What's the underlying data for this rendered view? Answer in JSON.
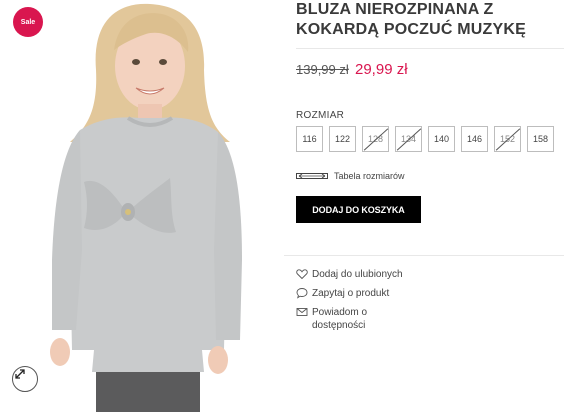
{
  "product": {
    "title": "BLUZA NIEROZPINANA Z KOKARDĄ POCZUĆ MUZYKĘ",
    "badge": "Sale",
    "old_price": "139,99 zł",
    "new_price": "29,99 zł",
    "accent_color": "#d9164f"
  },
  "sizes": {
    "label": "ROZMIAR",
    "options": [
      {
        "value": "116",
        "available": true
      },
      {
        "value": "122",
        "available": true
      },
      {
        "value": "128",
        "available": false
      },
      {
        "value": "134",
        "available": false
      },
      {
        "value": "140",
        "available": true
      },
      {
        "value": "146",
        "available": true
      },
      {
        "value": "152",
        "available": false
      },
      {
        "value": "158",
        "available": true
      }
    ],
    "size_table_label": "Tabela rozmiarów"
  },
  "cart": {
    "add_label": "DODAJ DO KOSZYKA"
  },
  "actions": [
    {
      "icon": "heart-icon",
      "label": "Dodaj do ulubionych"
    },
    {
      "icon": "chat-bubble-icon",
      "label": "Zapytaj o produkt"
    },
    {
      "icon": "envelope-icon",
      "label": "Powiadom o dostępności"
    }
  ],
  "image": {
    "zoom_icon": "expand-icon"
  }
}
